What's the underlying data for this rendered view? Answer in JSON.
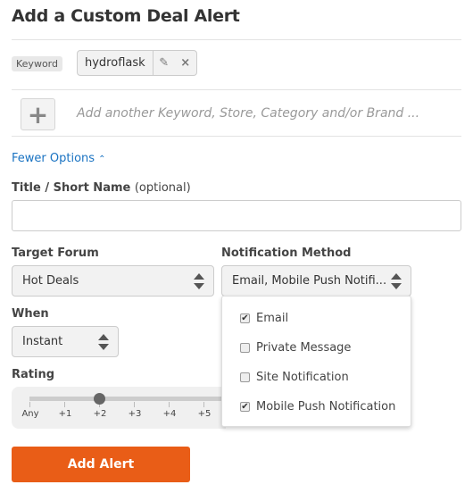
{
  "title": "Add a Custom Deal Alert",
  "keyword": {
    "label": "Keyword",
    "value": "hydroflask",
    "edit_icon": "pencil-icon",
    "remove_icon": "close-icon"
  },
  "add_another": {
    "icon": "plus-icon",
    "placeholder": "Add another Keyword, Store, Category and/or Brand ..."
  },
  "fewer_options": {
    "label": "Fewer Options",
    "icon": "chevron-up-icon"
  },
  "title_field": {
    "label": "Title / Short Name",
    "optional": "(optional)",
    "value": ""
  },
  "target_forum": {
    "label": "Target Forum",
    "value": "Hot Deals"
  },
  "notification": {
    "label": "Notification Method",
    "value": "Email, Mobile Push Notifi...",
    "options": [
      {
        "label": "Email",
        "checked": true
      },
      {
        "label": "Private Message",
        "checked": false
      },
      {
        "label": "Site Notification",
        "checked": false
      },
      {
        "label": "Mobile Push Notification",
        "checked": true
      }
    ]
  },
  "when": {
    "label": "When",
    "value": "Instant"
  },
  "rating": {
    "label": "Rating",
    "ticks": [
      "Any",
      "+1",
      "+2",
      "+3",
      "+4",
      "+5"
    ],
    "selected": "+2"
  },
  "submit": "Add Alert"
}
